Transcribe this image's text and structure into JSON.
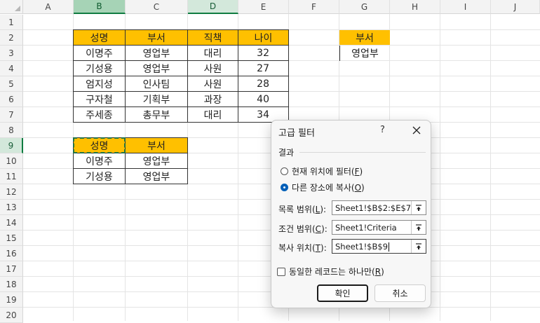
{
  "columns": [
    "A",
    "B",
    "C",
    "D",
    "E",
    "F",
    "G",
    "H",
    "I",
    "J"
  ],
  "rows": [
    "1",
    "2",
    "3",
    "4",
    "5",
    "6",
    "7",
    "8",
    "9",
    "10",
    "11",
    "12",
    "13",
    "14",
    "15",
    "16",
    "17",
    "18",
    "19",
    "20"
  ],
  "main_table": {
    "headers": [
      "성명",
      "부서",
      "직책",
      "나이"
    ],
    "rows": [
      [
        "이명주",
        "영업부",
        "대리",
        "32"
      ],
      [
        "기성용",
        "영업부",
        "사원",
        "27"
      ],
      [
        "엄지성",
        "인사팀",
        "사원",
        "28"
      ],
      [
        "구자철",
        "기획부",
        "과장",
        "40"
      ],
      [
        "주세종",
        "총무부",
        "대리",
        "34"
      ]
    ]
  },
  "criteria": {
    "header": "부서",
    "value": "영업부"
  },
  "result_table": {
    "headers": [
      "성명",
      "부서"
    ],
    "rows": [
      [
        "이명주",
        "영업부"
      ],
      [
        "기성용",
        "영업부"
      ]
    ]
  },
  "colors": {
    "header_fill": "#ffc000",
    "accent_green": "#107c41",
    "radio_blue": "#005fb8"
  },
  "dialog": {
    "title": "고급 필터",
    "help": "?",
    "section_label": "결과",
    "radio_filter_inplace": {
      "text": "현재 위치에 필터(",
      "key": "F",
      "suffix": ")"
    },
    "radio_copy": {
      "text": "다른 장소에 복사(",
      "key": "O",
      "suffix": ")",
      "selected": true
    },
    "list_range": {
      "text": "목록 범위(",
      "key": "L",
      "suffix": "):",
      "value": "Sheet1!$B$2:$E$7"
    },
    "criteria_range": {
      "text": "조건 범위(",
      "key": "C",
      "suffix": "):",
      "value": "Sheet1!Criteria"
    },
    "copy_to": {
      "text": "복사 위치(",
      "key": "T",
      "suffix": "):",
      "value": "Sheet1!$B$9"
    },
    "unique_checkbox": {
      "text": "동일한 레코드는 하나만(",
      "key": "R",
      "suffix": ")",
      "checked": false
    },
    "ok_label": "확인",
    "cancel_label": "취소"
  }
}
